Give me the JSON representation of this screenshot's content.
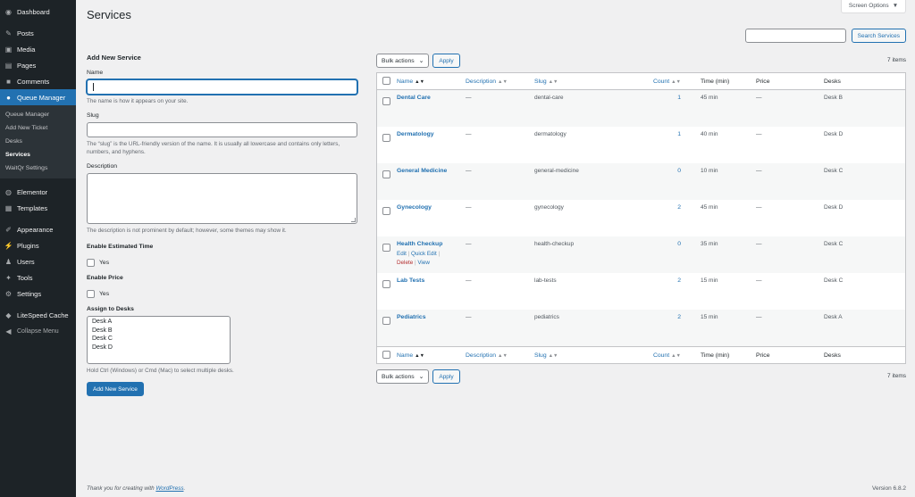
{
  "sidebar": {
    "items": [
      {
        "label": "Dashboard",
        "icon": "dashboard-icon"
      },
      {
        "label": "Posts",
        "icon": "pin-icon"
      },
      {
        "label": "Media",
        "icon": "media-icon"
      },
      {
        "label": "Pages",
        "icon": "pages-icon"
      },
      {
        "label": "Comments",
        "icon": "comments-icon"
      },
      {
        "label": "Queue Manager",
        "icon": "queue-icon"
      },
      {
        "label": "Elementor",
        "icon": "elementor-icon"
      },
      {
        "label": "Templates",
        "icon": "templates-icon"
      },
      {
        "label": "Appearance",
        "icon": "appearance-icon"
      },
      {
        "label": "Plugins",
        "icon": "plugins-icon"
      },
      {
        "label": "Users",
        "icon": "users-icon"
      },
      {
        "label": "Tools",
        "icon": "tools-icon"
      },
      {
        "label": "Settings",
        "icon": "settings-icon"
      },
      {
        "label": "LiteSpeed Cache",
        "icon": "litespeed-icon"
      },
      {
        "label": "Collapse Menu",
        "icon": "collapse-icon"
      }
    ],
    "submenu": [
      "Queue Manager",
      "Add New Ticket",
      "Desks",
      "Services",
      "WaitQr Settings"
    ]
  },
  "header": {
    "title": "Services",
    "screen_options": "Screen Options",
    "search_button": "Search Services",
    "search_value": ""
  },
  "form": {
    "heading": "Add New Service",
    "name_label": "Name",
    "name_help": "The name is how it appears on your site.",
    "slug_label": "Slug",
    "slug_help": "The “slug” is the URL-friendly version of the name. It is usually all lowercase and contains only letters, numbers, and hyphens.",
    "description_label": "Description",
    "description_help": "The description is not prominent by default; however, some themes may show it.",
    "estimated_label": "Enable Estimated Time",
    "estimated_yes": "Yes",
    "price_label": "Enable Price",
    "price_yes": "Yes",
    "desks_label": "Assign to Desks",
    "desks_options": [
      "Desk A",
      "Desk B",
      "Desk C",
      "Desk D"
    ],
    "desks_help": "Hold Ctrl (Windows) or Cmd (Mac) to select multiple desks.",
    "submit_label": "Add New Service"
  },
  "tablenav": {
    "bulk_label": "Bulk actions",
    "apply_label": "Apply",
    "items_count": "7 items"
  },
  "table": {
    "columns": {
      "name": "Name",
      "description": "Description",
      "slug": "Slug",
      "count": "Count",
      "time": "Time (min)",
      "price": "Price",
      "desks": "Desks"
    },
    "rows": [
      {
        "name": "Dental Care",
        "description": "—",
        "slug": "dental-care",
        "count": "1",
        "time": "45 min",
        "price": "—",
        "desk": "Desk B"
      },
      {
        "name": "Dermatology",
        "description": "—",
        "slug": "dermatology",
        "count": "1",
        "time": "40 min",
        "price": "—",
        "desk": "Desk D"
      },
      {
        "name": "General Medicine",
        "description": "—",
        "slug": "general-medicine",
        "count": "0",
        "time": "10 min",
        "price": "—",
        "desk": "Desk C"
      },
      {
        "name": "Gynecology",
        "description": "—",
        "slug": "gynecology",
        "count": "2",
        "time": "45 min",
        "price": "—",
        "desk": "Desk D"
      },
      {
        "name": "Health Checkup",
        "description": "—",
        "slug": "health-checkup",
        "count": "0",
        "time": "35 min",
        "price": "—",
        "desk": "Desk C"
      },
      {
        "name": "Lab Tests",
        "description": "—",
        "slug": "lab-tests",
        "count": "2",
        "time": "15 min",
        "price": "—",
        "desk": "Desk C"
      },
      {
        "name": "Pediatrics",
        "description": "—",
        "slug": "pediatrics",
        "count": "2",
        "time": "15 min",
        "price": "—",
        "desk": "Desk A"
      }
    ],
    "row_actions": {
      "edit": "Edit",
      "quick_edit": "Quick Edit",
      "delete": "Delete",
      "view": "View",
      "sep": "|"
    }
  },
  "footer": {
    "thanks_prefix": "Thank you for creating with",
    "wordpress_link": "WordPress",
    "thanks_suffix": ".",
    "version": "Version 6.8.2"
  },
  "colors": {
    "accent": "#2271b1",
    "sidebar_bg": "#1d2327",
    "delete": "#b32d2e"
  }
}
